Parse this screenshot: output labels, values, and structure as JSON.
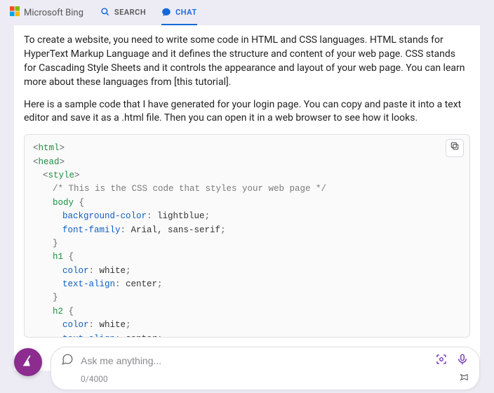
{
  "brand": {
    "name": "Microsoft Bing"
  },
  "tabs": {
    "search": {
      "label": "SEARCH"
    },
    "chat": {
      "label": "CHAT"
    }
  },
  "message": {
    "p1": "To create a website, you need to write some code in HTML and CSS languages. HTML stands for HyperText Markup Language and it defines the structure and content of your web page. CSS stands for Cascading Style Sheets and it controls the appearance and layout of your web page. You can learn more about these languages from [this tutorial].",
    "p2": "Here is a sample code that I have generated for your login page. You can copy and paste it into a text editor and save it as a .html file. Then you can open it in a web browser to see how it looks."
  },
  "code": {
    "l01_tag": "html",
    "l02_tag": "head",
    "l03_tag": "style",
    "l04_comment": "/* This is the CSS code that styles your web page */",
    "l05_sel": "body",
    "l06_prop": "background-color",
    "l06_val": "lightblue",
    "l07_prop": "font-family",
    "l07_val": "Arial, sans-serif",
    "l09_sel": "h1",
    "l10_prop": "color",
    "l10_val": "white",
    "l11_prop": "text-align",
    "l11_val": "center",
    "l13_sel": "h2",
    "l14_prop": "color",
    "l14_val": "white",
    "l15_prop": "text-align",
    "l15_val": "center",
    "brace_open": "{",
    "brace_close": "}",
    "lt": "<",
    "gt": ">",
    "slash": "/",
    "colon": ": ",
    "semi": ";"
  },
  "input": {
    "placeholder": "Ask me anything...",
    "value": "",
    "counter": "0/4000"
  }
}
